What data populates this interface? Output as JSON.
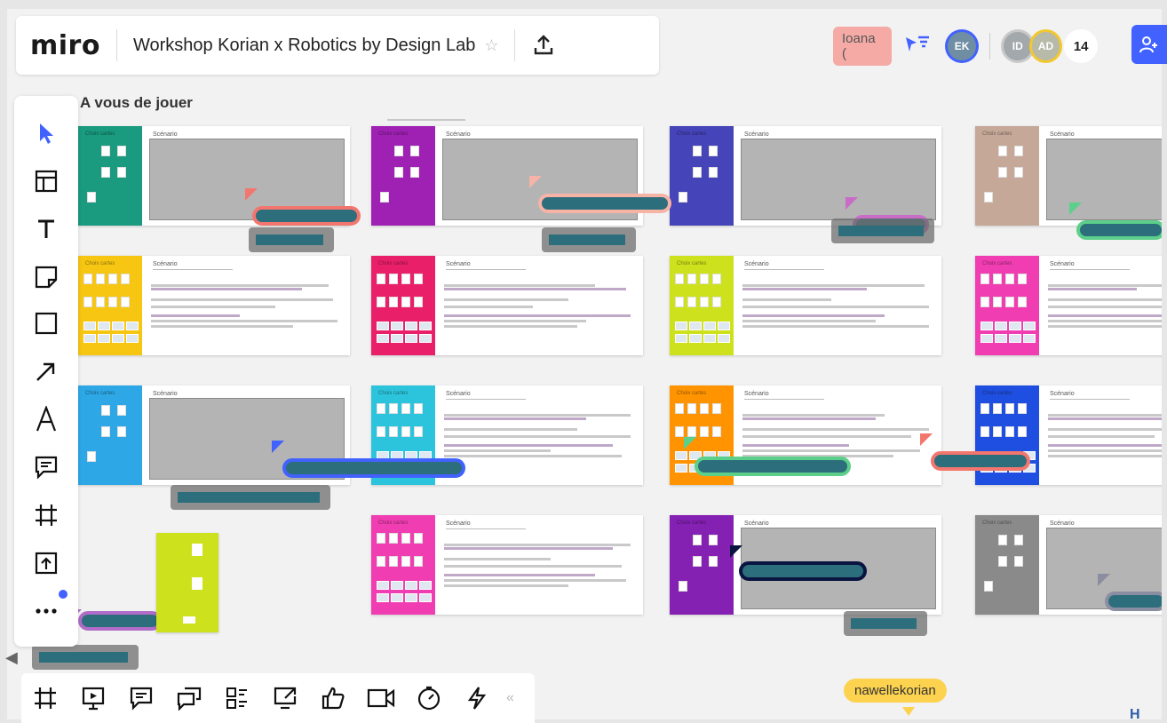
{
  "app": {
    "logo": "miro",
    "board_title": "Workshop Korian x Robotics by Design Lab"
  },
  "collaborators": {
    "name_pill": "Ioana (",
    "avatars": [
      {
        "initials": "EK",
        "color": "#6f8ea3",
        "ring": "#4262ff"
      },
      {
        "initials": "ID",
        "color": "#a2a8ab",
        "ring": "#c9c9c9"
      },
      {
        "initials": "AD",
        "color": "#b7b9a9",
        "ring": "#f2c830"
      }
    ],
    "count": "14"
  },
  "frame": {
    "title": "A vous de jouer"
  },
  "cards": {
    "side_title": "Choix cartes",
    "scenario_label": "Scénario",
    "items": [
      {
        "color": "#1a9a7e",
        "style": "gray"
      },
      {
        "color": "#9f21b3",
        "style": "gray"
      },
      {
        "color": "#4544b8",
        "style": "gray"
      },
      {
        "color": "#c5a898",
        "style": "gray"
      },
      {
        "color": "#f6c613",
        "style": "text"
      },
      {
        "color": "#ea1f6a",
        "style": "text"
      },
      {
        "color": "#cde11c",
        "style": "text"
      },
      {
        "color": "#f03db1",
        "style": "text"
      },
      {
        "color": "#2da7e6",
        "style": "gray"
      },
      {
        "color": "#2cc4dc",
        "style": "text"
      },
      {
        "color": "#ff9400",
        "style": "text"
      },
      {
        "color": "#1f4fe0",
        "style": "text"
      },
      {
        "color": "#f03db1",
        "style": "text"
      },
      {
        "color": "#8421b3",
        "style": "gray"
      },
      {
        "color": "#8a8a8a",
        "style": "gray"
      }
    ]
  },
  "cursor_colors": [
    "#f3766e",
    "#f6b3a6",
    "#c86cc8",
    "#5ccf8a",
    "#4262ff",
    "#5ccf8a",
    "#f3766e",
    "#0a1440",
    "#8a8ea0",
    "#b06cc8"
  ],
  "bottom_toolbar": {
    "collapse": "«"
  },
  "nawelle": {
    "name": "nawellekorian"
  },
  "corner_logo": "H",
  "nav_arrow": "◀"
}
